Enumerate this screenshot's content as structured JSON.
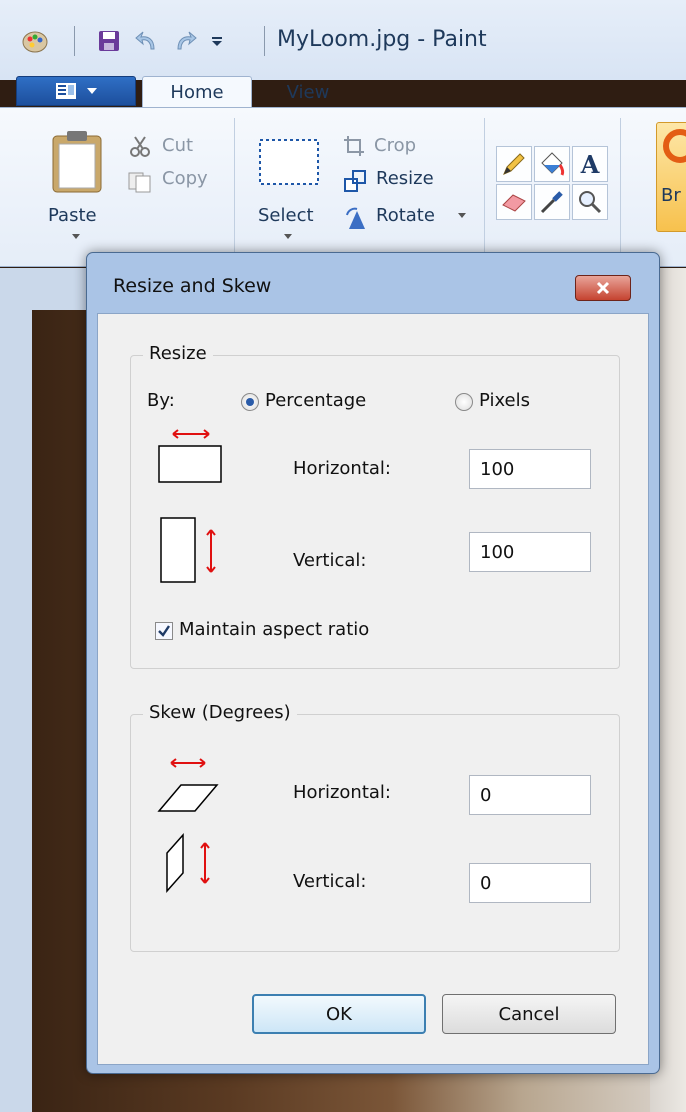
{
  "window": {
    "title": "MyLoom.jpg - Paint"
  },
  "quick_access": {
    "icons": [
      "paint-app-icon",
      "save-icon",
      "undo-icon",
      "redo-icon",
      "customize-dropdown-icon"
    ]
  },
  "ribbon": {
    "tabs": [
      {
        "label": "Home",
        "active": true
      },
      {
        "label": "View",
        "active": false
      }
    ],
    "clipboard": {
      "paste_label": "Paste",
      "cut_label": "Cut",
      "copy_label": "Copy"
    },
    "image": {
      "select_label": "Select",
      "crop_label": "Crop",
      "resize_label": "Resize",
      "rotate_label": "Rotate"
    },
    "tools": {
      "icons": [
        "pencil-icon",
        "fill-icon",
        "text-icon",
        "eraser-icon",
        "color-picker-icon",
        "magnifier-icon"
      ],
      "text_glyph": "A"
    },
    "brushes_label": "Br"
  },
  "dialog": {
    "title": "Resize and Skew",
    "resize": {
      "group_label": "Resize",
      "by_label": "By:",
      "options": [
        {
          "label": "Percentage",
          "selected": true
        },
        {
          "label": "Pixels",
          "selected": false
        }
      ],
      "horizontal_label": "Horizontal:",
      "horizontal_value": "100",
      "vertical_label": "Vertical:",
      "vertical_value": "100",
      "maintain_aspect_label": "Maintain aspect ratio",
      "maintain_aspect_checked": true
    },
    "skew": {
      "group_label": "Skew (Degrees)",
      "horizontal_label": "Horizontal:",
      "horizontal_value": "0",
      "vertical_label": "Vertical:",
      "vertical_value": "0"
    },
    "ok_label": "OK",
    "cancel_label": "Cancel"
  },
  "colors": {
    "accent": "#3c7fb1",
    "close_button": "#c54330",
    "arrow_red": "#e01010"
  }
}
